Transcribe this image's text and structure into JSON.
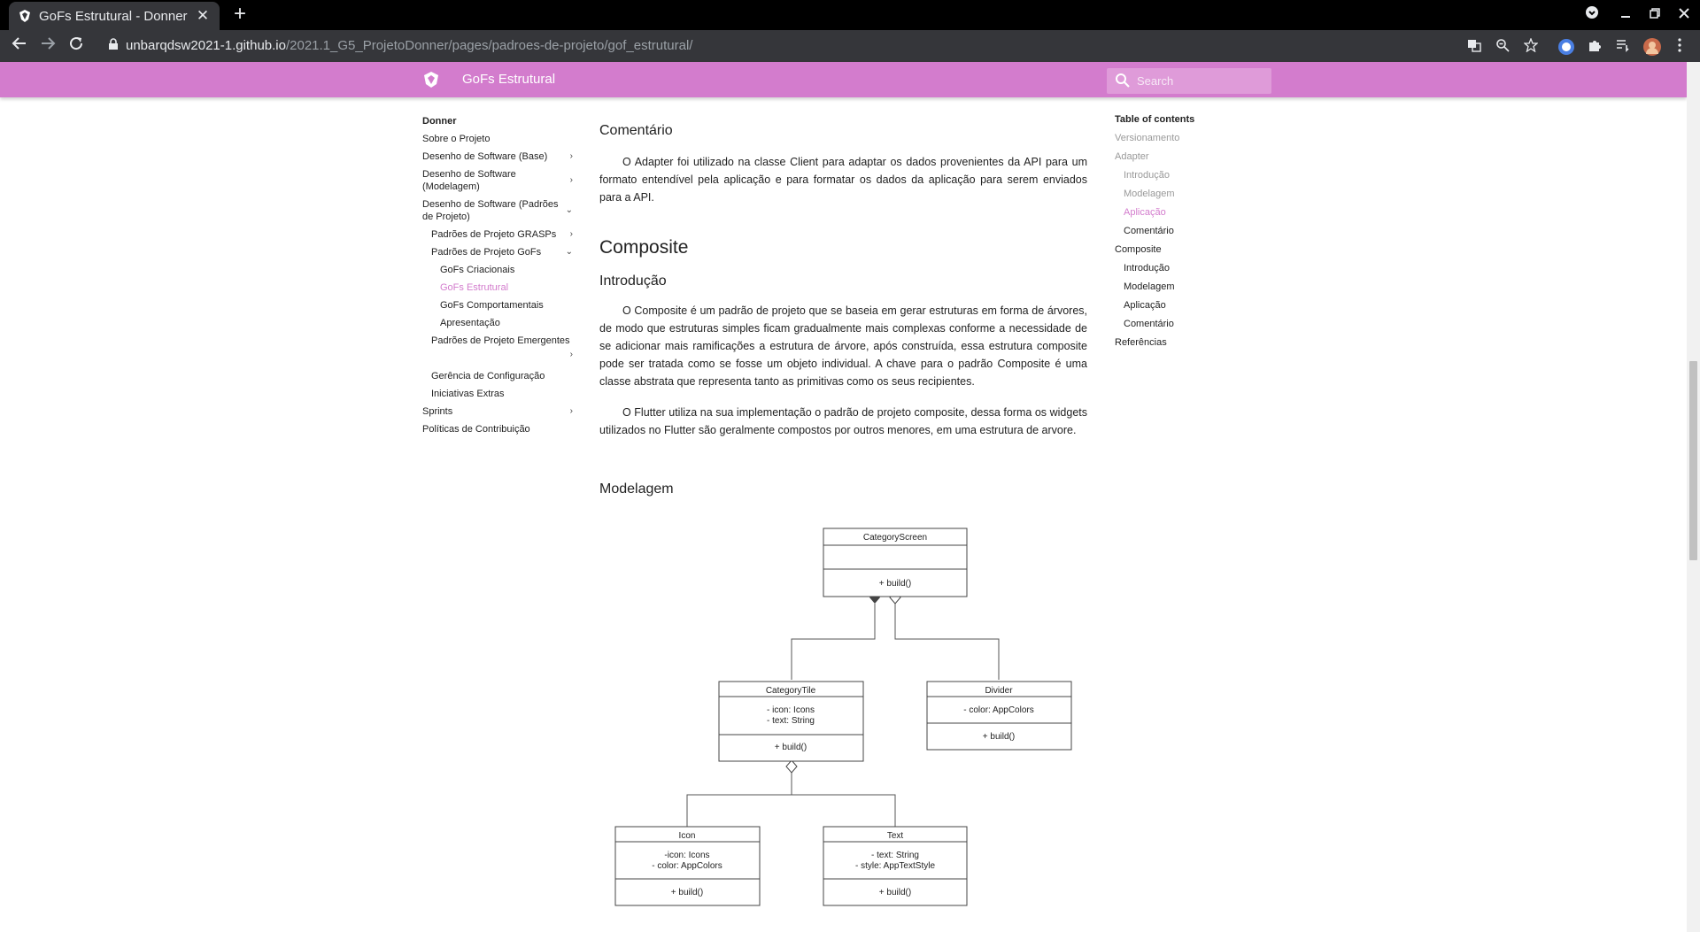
{
  "browser": {
    "tab_title": "GoFs Estrutural - Donner",
    "tab_close": "✕",
    "new_tab": "+",
    "url_host": "unbarqdsw2021-1.github.io",
    "url_path": "/2021.1_G5_ProjetoDonner/pages/padroes-de-projeto/gof_estrutural/"
  },
  "header": {
    "site_title": "GoFs Estrutural",
    "search_placeholder": "Search",
    "accent_color": "#d37ccd"
  },
  "leftnav": {
    "root": "Donner",
    "items": [
      {
        "label": "Sobre o Projeto",
        "level": 1,
        "chevron": ""
      },
      {
        "label": "Desenho de Software (Base)",
        "level": 1,
        "chevron": "›"
      },
      {
        "label": "Desenho de Software (Modelagem)",
        "level": 1,
        "chevron": "›"
      },
      {
        "label": "Desenho de Software (Padrões de Projeto)",
        "level": 1,
        "chevron": "⌄"
      },
      {
        "label": "Padrões de Projeto GRASPs",
        "level": 2,
        "chevron": "›"
      },
      {
        "label": "Padrões de Projeto GoFs",
        "level": 2,
        "chevron": "⌄"
      },
      {
        "label": "GoFs Criacionais",
        "level": 3,
        "chevron": ""
      },
      {
        "label": "GoFs Estrutural",
        "level": 3,
        "chevron": "",
        "active": true
      },
      {
        "label": "GoFs Comportamentais",
        "level": 3,
        "chevron": ""
      },
      {
        "label": "Apresentação",
        "level": 3,
        "chevron": ""
      },
      {
        "label": "Padrões de Projeto Emergentes",
        "level": 2,
        "chevron": "›"
      },
      {
        "label": "Gerência de Configuração",
        "level": 2,
        "chevron": ""
      },
      {
        "label": "Iniciativas Extras",
        "level": 2,
        "chevron": ""
      },
      {
        "label": "Sprints",
        "level": 1,
        "chevron": "›"
      },
      {
        "label": "Políticas de Contribuição",
        "level": 1,
        "chevron": ""
      }
    ]
  },
  "content": {
    "comentario_title": "Comentário",
    "comentario_text": "O Adapter foi utilizado na classe Client para adaptar os dados provenientes da API para um formato entendível pela aplicação e para formatar os dados da aplicação para serem enviados para a API.",
    "composite_title": "Composite",
    "introducao_title": "Introdução",
    "intro_p1": "O Composite é um padrão de projeto que se baseia em gerar estruturas em forma de árvores, de modo que estruturas simples ficam gradualmente mais complexas conforme a necessidade de se adicionar mais ramificações a estrutura de árvore, após construída, essa estrutura composite pode ser tratada como se fosse um objeto individual. A chave para o padrão Composite é uma classe abstrata que representa tanto as primitivas como os seus recipientes.",
    "intro_p2": "O Flutter utiliza na sua implementação o padrão de projeto composite, dessa forma os widgets utilizados no Flutter são geralmente compostos por outros menores, em uma estrutura de arvore.",
    "modelagem_title": "Modelagem"
  },
  "uml": {
    "category_screen": {
      "name": "CategoryScreen",
      "attrs": [],
      "method": "+ build()"
    },
    "category_tile": {
      "name": "CategoryTile",
      "attrs": [
        "- icon: Icons",
        "- text: String"
      ],
      "method": "+ build()"
    },
    "divider": {
      "name": "Divider",
      "attrs": [
        "- color: AppColors"
      ],
      "method": "+ build()"
    },
    "icon": {
      "name": "Icon",
      "attrs": [
        "-icon: Icons",
        "- color: AppColors"
      ],
      "method": "+ build()"
    },
    "text": {
      "name": "Text",
      "attrs": [
        "- text: String",
        "- style: AppTextStyle"
      ],
      "method": "+ build()"
    }
  },
  "toc": {
    "title": "Table of contents",
    "items": [
      {
        "label": "Versionamento",
        "sub": false,
        "state": "grey"
      },
      {
        "label": "Adapter",
        "sub": false,
        "state": "grey"
      },
      {
        "label": "Introdução",
        "sub": true,
        "state": "grey"
      },
      {
        "label": "Modelagem",
        "sub": true,
        "state": "grey"
      },
      {
        "label": "Aplicação",
        "sub": true,
        "state": "active"
      },
      {
        "label": "Comentário",
        "sub": true,
        "state": "normal"
      },
      {
        "label": "Composite",
        "sub": false,
        "state": "normal"
      },
      {
        "label": "Introdução",
        "sub": true,
        "state": "normal"
      },
      {
        "label": "Modelagem",
        "sub": true,
        "state": "normal"
      },
      {
        "label": "Aplicação",
        "sub": true,
        "state": "normal"
      },
      {
        "label": "Comentário",
        "sub": true,
        "state": "normal"
      },
      {
        "label": "Referências",
        "sub": false,
        "state": "normal"
      }
    ]
  }
}
